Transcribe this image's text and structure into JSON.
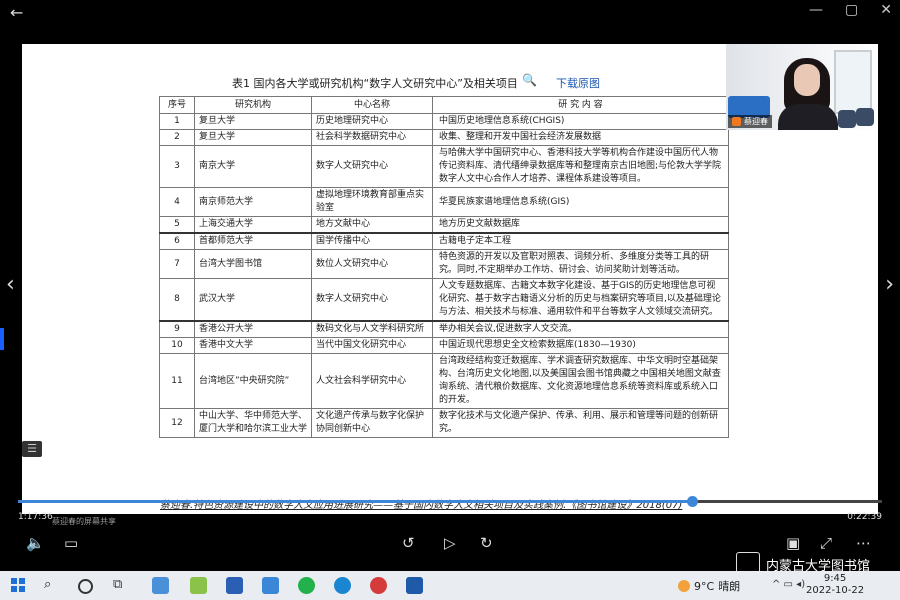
{
  "slide": {
    "caption": "表1 国内各大学或研究机构“数字人文研究中心”及相关项目",
    "download_link": "下载原图",
    "columns": [
      "序号",
      "研究机构",
      "中心名称",
      "研 究 内 容"
    ],
    "rows": [
      {
        "n": "1",
        "inst": "复旦大学",
        "center": "历史地理研究中心",
        "content": "中国历史地理信息系统(CHGIS)"
      },
      {
        "n": "2",
        "inst": "复旦大学",
        "center": "社会科学数据研究中心",
        "content": "收集、整理和开发中国社会经济发展数据"
      },
      {
        "n": "3",
        "inst": "南京大学",
        "center": "数字人文研究中心",
        "content": "与哈佛大学中国研究中心、香港科技大学等机构合作建设中国历代人物传记资料库、清代缙绅录数据库等和整理南京古旧地图;与伦敦大学学院数字人文中心合作人才培养、课程体系建设等项目。"
      },
      {
        "n": "4",
        "inst": "南京师范大学",
        "center": "虚拟地理环境教育部重点实验室",
        "content": "华夏民族家谱地理信息系统(GIS)"
      },
      {
        "n": "5",
        "inst": "上海交通大学",
        "center": "地方文献中心",
        "content": "地方历史文献数据库"
      },
      {
        "n": "6",
        "inst": "首都师范大学",
        "center": "国学传播中心",
        "content": "古籍电子定本工程"
      },
      {
        "n": "7",
        "inst": "台湾大学图书馆",
        "center": "数位人文研究中心",
        "content": "特色资源的开发以及官职对照表、词频分析、多维度分类等工具的研究。同时,不定期举办工作坊、研讨会、访问奖助计划等活动。"
      },
      {
        "n": "8",
        "inst": "武汉大学",
        "center": "数字人文研究中心",
        "content": "人文专题数据库、古籍文本数字化建设、基于GIS的历史地理信息可视化研究、基于数字古籍语义分析的历史与档案研究等项目,以及基础理论与方法、相关技术与标准、通用软件和平台等数字人文领域交流研究。"
      },
      {
        "n": "9",
        "inst": "香港公开大学",
        "center": "数码文化与人文学科研究所",
        "content": "举办相关会议,促进数字人文交流。"
      },
      {
        "n": "10",
        "inst": "香港中文大学",
        "center": "当代中国文化研究中心",
        "content": "中国近现代思想史全文检索数据库(1830—1930)"
      },
      {
        "n": "11",
        "inst": "台湾地区”中央研究院”",
        "center": "人文社会科学研究中心",
        "content": "台湾政经结构变迁数据库、学术调查研究数据库、中华文明时空基础架构、台湾历史文化地图,以及美国国会图书馆典藏之中国相关地图文献查询系统、清代粮价数据库、文化资源地理信息系统等资料库或系统入口的开发。"
      },
      {
        "n": "12",
        "inst": "中山大学、华中师范大学、厦门大学和哈尔滨工业大学",
        "center": "文化遗产传承与数字化保护协同创新中心",
        "content": "数字化技术与文化遗产保护、传承、利用、展示和管理等问题的创新研究。"
      }
    ],
    "citation": "蔡迎春.特色资源建设中的数字人文应用进展研究——基于国内数字人文相关项目及实践案例.《图书馆建设》2018(07)"
  },
  "video": {
    "participant_name": "蔡迎春",
    "share_label": "蔡迎春的屏幕共享"
  },
  "player": {
    "elapsed": "1:17:36",
    "total": "0:22:39",
    "progress": 0.78,
    "watermark": "内蒙古大学图书馆"
  },
  "taskbar": {
    "temperature": "9°C",
    "weather": "晴朗",
    "time": "9:45",
    "date": "2022-10-22"
  }
}
